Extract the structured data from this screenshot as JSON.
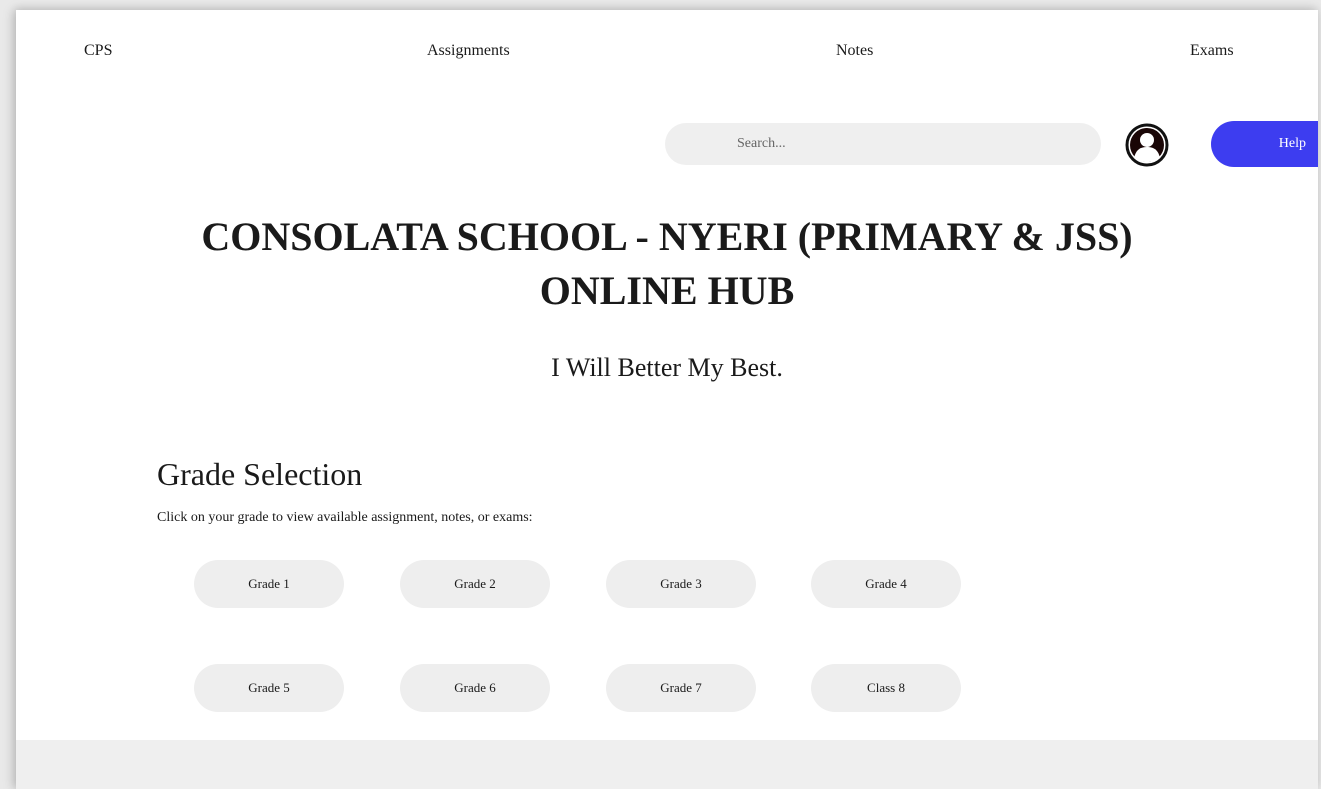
{
  "nav": {
    "items": [
      {
        "label": "CPS"
      },
      {
        "label": "Assignments"
      },
      {
        "label": "Notes"
      },
      {
        "label": "Exams"
      }
    ]
  },
  "search": {
    "placeholder": "Search..."
  },
  "help": {
    "label": "Help",
    "color": "#3d3df0"
  },
  "hero": {
    "title_line1": "CONSOLATA SCHOOL - NYERI (PRIMARY & JSS)",
    "title_line2": "ONLINE HUB",
    "motto": "I Will Better My Best."
  },
  "grades": {
    "heading": "Grade Selection",
    "description": "Click on your grade to view available assignment, notes, or exams:",
    "items": [
      {
        "label": "Grade 1"
      },
      {
        "label": "Grade 2"
      },
      {
        "label": "Grade 3"
      },
      {
        "label": "Grade 4"
      },
      {
        "label": "Grade 5"
      },
      {
        "label": "Grade 6"
      },
      {
        "label": "Grade 7"
      },
      {
        "label": "Class 8"
      }
    ]
  },
  "icons": {
    "avatar": "user-avatar-icon"
  }
}
